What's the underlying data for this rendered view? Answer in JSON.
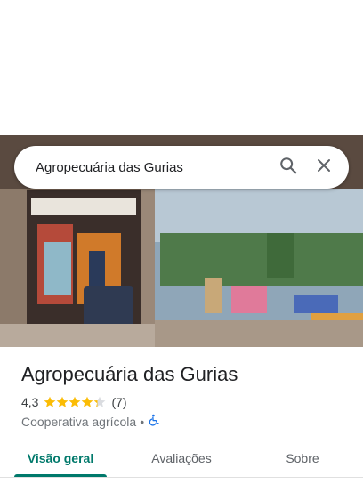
{
  "search": {
    "query": "Agropecuária das Gurias"
  },
  "place": {
    "name": "Agropecuária das Gurias",
    "rating": "4,3",
    "star_value": 4.3,
    "reviews": "(7)",
    "category": "Cooperativa agrícola",
    "separator": "•"
  },
  "tabs": [
    {
      "label": "Visão geral",
      "active": true
    },
    {
      "label": "Avaliações",
      "active": false
    },
    {
      "label": "Sobre",
      "active": false
    }
  ],
  "colors": {
    "accent": "#00796b",
    "star": "#fbbc04",
    "accessible": "#1a73e8"
  },
  "icons": {
    "search": "search-icon",
    "close": "close-icon",
    "accessible": "wheelchair-icon"
  }
}
